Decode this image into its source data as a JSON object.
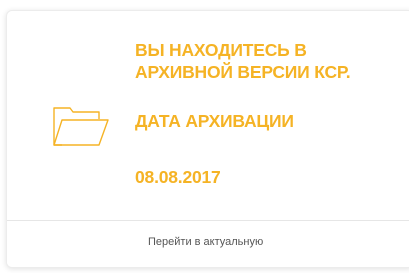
{
  "card": {
    "message_line1": "ВЫ НАХОДИТЕСЬ В",
    "message_line2": "АРХИВНОЙ ВЕРСИИ КСР.",
    "date_label": "ДАТА АРХИВАЦИИ",
    "date_value": "08.08.2017",
    "icon": "folder-open-icon",
    "accent_color": "#f5b325"
  },
  "footer": {
    "link_label": "Перейти в актуальную"
  }
}
